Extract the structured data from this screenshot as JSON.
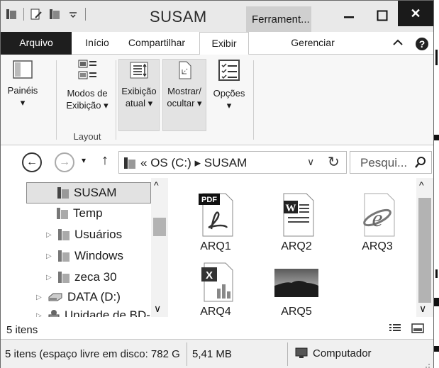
{
  "window": {
    "title": "SUSAM",
    "contextual_tab": "Ferrament...",
    "close_glyph": "✕"
  },
  "tabs": {
    "arquivo": "Arquivo",
    "inicio": "Início",
    "compartilhar": "Compartilhar",
    "exibir": "Exibir",
    "gerenciar": "Gerenciar",
    "collapse": "^",
    "help": "?"
  },
  "ribbon": {
    "paineis": {
      "line1": "Painéis",
      "line2": "▾"
    },
    "modos": {
      "line1": "Modos de",
      "line2": "Exibição ▾"
    },
    "exibicao": {
      "line1": "Exibição",
      "line2": "atual ▾"
    },
    "mostrar": {
      "line1": "Mostrar/",
      "line2": "ocultar ▾"
    },
    "opcoes": {
      "line1": "Opções",
      "line2": "▾"
    },
    "group_layout": "Layout"
  },
  "nav": {
    "back": "←",
    "forward": "→",
    "recent": "▾",
    "up": "↑",
    "address_chevron": "«",
    "address_path": "OS (C:) ▸ SUSAM",
    "address_dropdown": "∨",
    "refresh": "↻",
    "search_placeholder": "Pesqui..."
  },
  "tree": {
    "items": [
      {
        "label": "SUSAM",
        "expander": ""
      },
      {
        "label": "Temp",
        "expander": ""
      },
      {
        "label": "Usuários",
        "expander": "▷"
      },
      {
        "label": "Windows",
        "expander": "▷"
      },
      {
        "label": "zeca 30",
        "expander": "▷"
      },
      {
        "label": "DATA (D:)",
        "expander": "▷"
      },
      {
        "label": "Unidade de BD-",
        "expander": "▷"
      }
    ],
    "scroll_up": "^",
    "scroll_down": "∨"
  },
  "files": [
    {
      "name": "ARQ1",
      "type": "pdf"
    },
    {
      "name": "ARQ2",
      "type": "word"
    },
    {
      "name": "ARQ3",
      "type": "ie"
    },
    {
      "name": "ARQ4",
      "type": "excel"
    },
    {
      "name": "ARQ5",
      "type": "image"
    }
  ],
  "content_scroll": {
    "up": "^",
    "down": "∨"
  },
  "status": {
    "count": "5 itens",
    "disk": "5 itens (espaço livre em disco: 782 G",
    "size": "5,41 MB",
    "location": "Computador"
  }
}
